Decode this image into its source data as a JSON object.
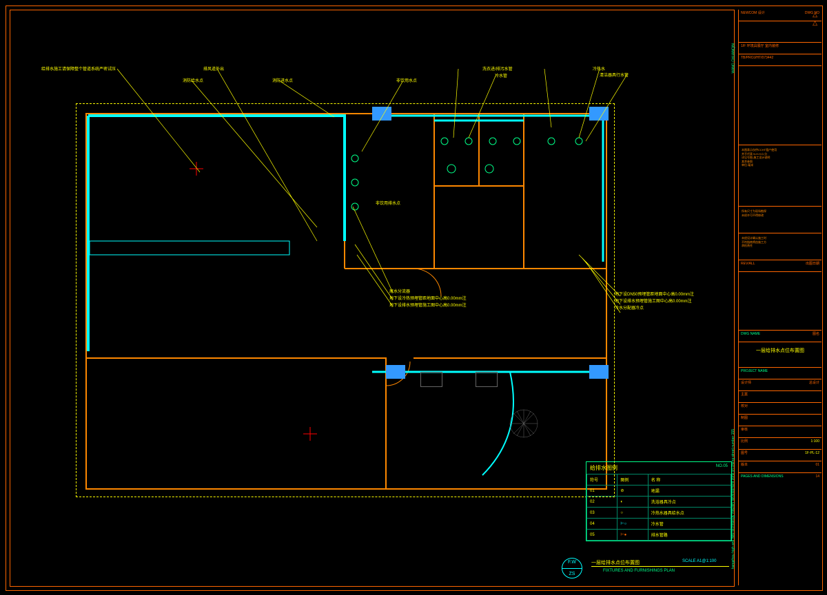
{
  "titleblock": {
    "vertical_project": "hangzhou high and new technology industry development zone jin cheng street number 155",
    "vertical_code": "WANG CHUANQIN",
    "row1_a": "NEWCOM 设计",
    "row1_b": "DWG NO",
    "row2": "1/F 环境具展厅 室内装修",
    "row3": "TB/PROJ/HT/073442",
    "notes1": "NOTES:",
    "notes2": "本图表示仅供CCHT租户使用\n并不代表 N.H.H.D.分\n详见号图-施工设计说明\n其余参照\n单位:毫米",
    "notes3": "所有尺寸为现场勘探\n未经许可不得修改",
    "notes4": "未经设计确认施工时\n不符指南将由施工方\n承担责任",
    "rev_label": "REV/ALL",
    "rev_val": "出图日期",
    "sheet_title_main": "一层给排水点位布置图",
    "f_project": "PROJECT NAME",
    "f_project_v": "",
    "f_1": "设计师",
    "f_1v": "总设计",
    "f_2": "主案",
    "f_2v": "",
    "f_3": "校对",
    "f_3v": "",
    "f_4": "制图",
    "f_4v": "",
    "f_5": "审核",
    "f_5v": "",
    "f_scale": "比例",
    "f_scale_v": "1:100",
    "f_dwg": "图号",
    "f_dwg_v": "1F-PL-12",
    "f_rev": "版本",
    "f_rev_v": "01",
    "f_date": "PAGES AND DIMENSIONS",
    "f_date_v": "14"
  },
  "callouts": {
    "c1": "给排水施工请保障整个管道系统严密试压",
    "c2": "排风道外出",
    "c3": "消防给水点",
    "c4": "消防进水点",
    "c5": "非饮用水点",
    "c6": "洗衣进/排污水管",
    "c7": "冷水管",
    "c8": "清洁器具行水管",
    "c9": "冷热水",
    "c10": "非饮用排水点",
    "c11": "尾水分流器",
    "c12": "地下设冷热预埋管距地面中心高0.00mm注",
    "c13": "地下设排水预埋管施工图中心高0.00mm注",
    "c14": "地下设DN50预埋管距地面中心高0.00mm注",
    "c15": "地下设排水预埋管施工图中心高0.00mm注",
    "c16": "冷水分配器冷点"
  },
  "legend": {
    "title": "给排水图例",
    "title_right": "NO.05",
    "h1": "符号",
    "h2": "图例",
    "h3": "名 称",
    "r1_a": "01",
    "r1_c": "地漏",
    "r2_a": "02",
    "r2_c": "洗浴器具冷点",
    "r3_a": "03",
    "r3_c": "冷热水器具给水点",
    "r4_a": "04",
    "r4_c": "冷水管",
    "r5_a": "05",
    "r5_c": "排水管路"
  },
  "title": {
    "stamp_top": "F.W",
    "stamp_bot": "ZS",
    "main": "一层给排水点位布置图",
    "scale": "SCALE A1@1:100",
    "sub": "FIXTURES AND FURNISHINGS PLAN"
  }
}
